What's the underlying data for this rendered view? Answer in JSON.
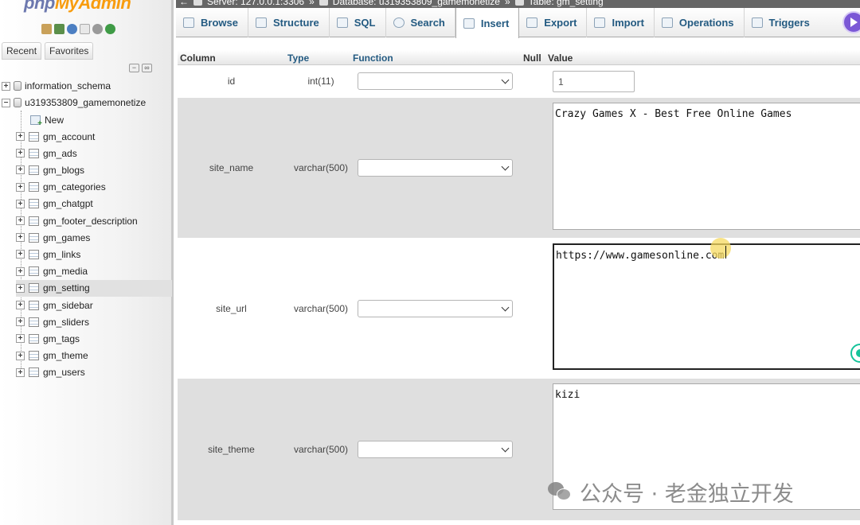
{
  "app": {
    "logo_php": "php",
    "logo_rest": "MyAdmin"
  },
  "sidebar": {
    "nav_tabs": [
      "Recent",
      "Favorites"
    ],
    "databases": [
      {
        "name": "information_schema",
        "expanded": false
      },
      {
        "name": "u319353809_gamemonetize",
        "expanded": true
      }
    ],
    "new_label": "New",
    "tables": [
      "gm_account",
      "gm_ads",
      "gm_blogs",
      "gm_categories",
      "gm_chatgpt",
      "gm_footer_description",
      "gm_games",
      "gm_links",
      "gm_media",
      "gm_setting",
      "gm_sidebar",
      "gm_sliders",
      "gm_tags",
      "gm_theme",
      "gm_users"
    ],
    "active_table": "gm_setting"
  },
  "breadcrumb": {
    "server": "Server: 127.0.0.1:3306",
    "sep": "»",
    "database": "Database: u319353809_gamemonetize",
    "table": "Table: gm_setting"
  },
  "tabs": [
    "Browse",
    "Structure",
    "SQL",
    "Search",
    "Insert",
    "Export",
    "Import",
    "Operations",
    "Triggers"
  ],
  "active_tab": "Insert",
  "table_header": {
    "column": "Column",
    "type": "Type",
    "function": "Function",
    "null": "Null",
    "value": "Value"
  },
  "rows": [
    {
      "column": "id",
      "type": "int(11)",
      "value": "1"
    },
    {
      "column": "site_name",
      "type": "varchar(500)",
      "value": "Crazy Games X - Best Free Online Games"
    },
    {
      "column": "site_url",
      "type": "varchar(500)",
      "value": "https://www.gamesonline.com"
    },
    {
      "column": "site_theme",
      "type": "varchar(500)",
      "value": "kizi"
    }
  ],
  "watermark": {
    "text": "公众号 · 老金独立开发"
  },
  "colors": {
    "tab_text": "#235a81",
    "logo_php": "#6c78af",
    "logo_rest": "#f89c0e",
    "breadcrumb_bg": "#666666",
    "row_gray": "#dfdfdf"
  }
}
